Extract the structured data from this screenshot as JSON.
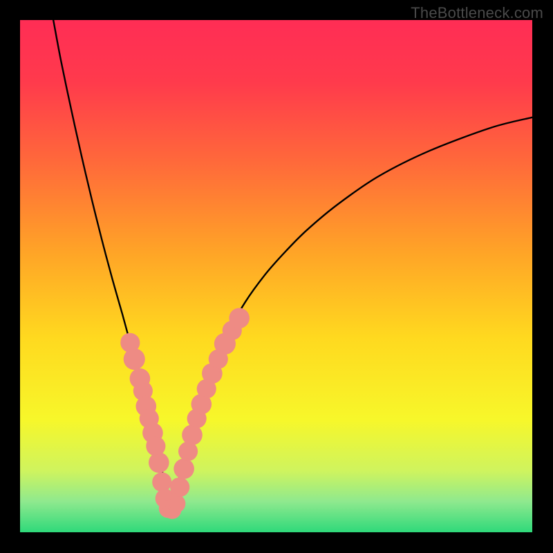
{
  "watermark": "TheBottleneck.com",
  "chart_data": {
    "type": "line",
    "title": "",
    "xlabel": "",
    "ylabel": "",
    "xlim": [
      0,
      100
    ],
    "ylim": [
      0,
      100
    ],
    "grid": false,
    "legend": false,
    "background_gradient": {
      "type": "vertical",
      "stops": [
        {
          "offset": 0.0,
          "color": "#ff2d55"
        },
        {
          "offset": 0.12,
          "color": "#ff3a4c"
        },
        {
          "offset": 0.28,
          "color": "#ff6a3a"
        },
        {
          "offset": 0.45,
          "color": "#ffa327"
        },
        {
          "offset": 0.62,
          "color": "#ffd91f"
        },
        {
          "offset": 0.78,
          "color": "#f7f72a"
        },
        {
          "offset": 0.88,
          "color": "#cff45e"
        },
        {
          "offset": 0.94,
          "color": "#8fe98e"
        },
        {
          "offset": 1.0,
          "color": "#2fd97a"
        }
      ]
    },
    "curve": {
      "description": "V-shaped bottleneck curve: steep descent from top-left, minimum near x≈29, more gradual rise to top-right",
      "x": [
        6.5,
        8,
        10,
        12,
        14,
        16,
        18,
        20,
        21.5,
        23,
        24.5,
        26,
        27,
        28,
        29,
        30,
        31,
        32,
        33.5,
        35,
        37,
        40,
        44,
        48,
        52,
        56,
        62,
        70,
        80,
        92,
        100
      ],
      "y": [
        100,
        92,
        82.5,
        73.5,
        65,
        57,
        49.5,
        42.5,
        37,
        31.5,
        26.5,
        21.5,
        16.5,
        10.5,
        4,
        4,
        10,
        15.5,
        21,
        26,
        31.5,
        38,
        45,
        50.5,
        55,
        59,
        64,
        69.5,
        74.5,
        79,
        81
      ]
    },
    "curve_plateau": {
      "description": "Flat bottom segment of the V between the two curve halves",
      "x": [
        27.8,
        30.6
      ],
      "y": [
        3.8,
        3.8
      ]
    },
    "markers": {
      "description": "Pink blob markers clustered on lower portions of both curve arms",
      "color": "#ee8b84",
      "points": [
        {
          "x": 21.5,
          "y": 37.0,
          "r": 1.9
        },
        {
          "x": 22.3,
          "y": 33.8,
          "r": 2.1
        },
        {
          "x": 23.4,
          "y": 30.0,
          "r": 2.0
        },
        {
          "x": 24.0,
          "y": 27.6,
          "r": 1.9
        },
        {
          "x": 24.6,
          "y": 24.6,
          "r": 2.0
        },
        {
          "x": 25.2,
          "y": 22.2,
          "r": 1.9
        },
        {
          "x": 25.9,
          "y": 19.4,
          "r": 2.0
        },
        {
          "x": 26.5,
          "y": 16.8,
          "r": 1.9
        },
        {
          "x": 27.1,
          "y": 13.6,
          "r": 2.0
        },
        {
          "x": 27.7,
          "y": 9.8,
          "r": 1.9
        },
        {
          "x": 28.3,
          "y": 6.6,
          "r": 1.9
        },
        {
          "x": 28.9,
          "y": 4.6,
          "r": 1.8
        },
        {
          "x": 29.7,
          "y": 4.4,
          "r": 1.8
        },
        {
          "x": 30.5,
          "y": 5.6,
          "r": 1.8
        },
        {
          "x": 31.2,
          "y": 8.8,
          "r": 1.9
        },
        {
          "x": 32.0,
          "y": 12.4,
          "r": 2.0
        },
        {
          "x": 32.8,
          "y": 15.8,
          "r": 1.9
        },
        {
          "x": 33.6,
          "y": 19.0,
          "r": 2.0
        },
        {
          "x": 34.5,
          "y": 22.2,
          "r": 1.9
        },
        {
          "x": 35.4,
          "y": 25.0,
          "r": 2.0
        },
        {
          "x": 36.4,
          "y": 28.0,
          "r": 1.9
        },
        {
          "x": 37.5,
          "y": 31.0,
          "r": 2.0
        },
        {
          "x": 38.7,
          "y": 33.8,
          "r": 1.9
        },
        {
          "x": 40.0,
          "y": 36.8,
          "r": 2.1
        },
        {
          "x": 41.4,
          "y": 39.4,
          "r": 1.9
        },
        {
          "x": 42.8,
          "y": 41.8,
          "r": 2.0
        }
      ]
    }
  }
}
